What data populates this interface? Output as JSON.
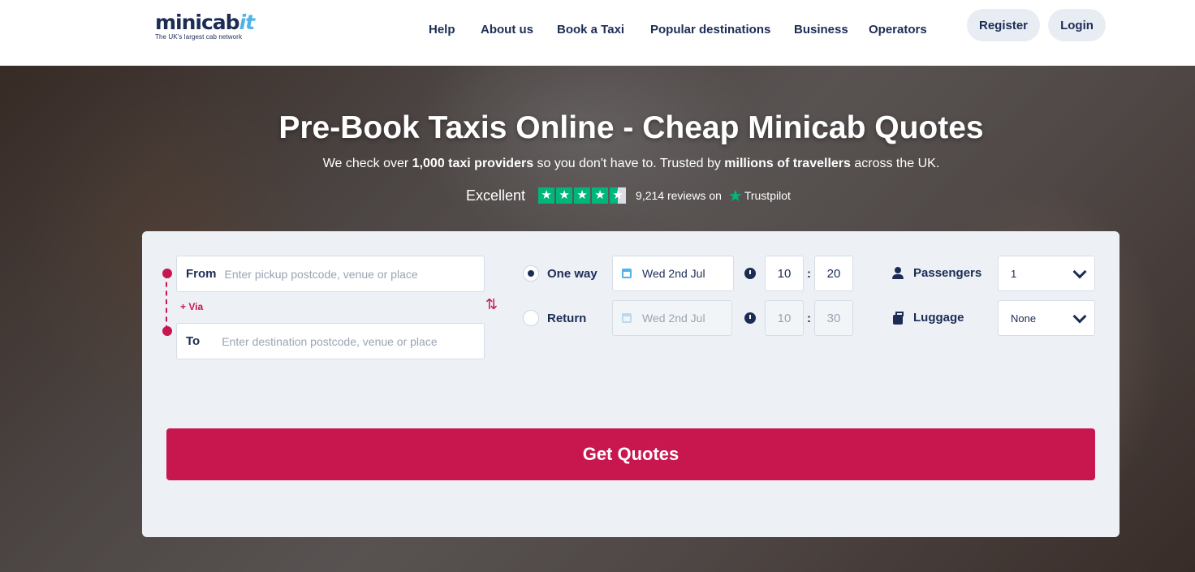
{
  "brand": {
    "logo_main": "minicab",
    "logo_accent": "it",
    "tagline": "The UK's largest cab network"
  },
  "nav": {
    "items": [
      {
        "label": "Help"
      },
      {
        "label": "About us"
      },
      {
        "label": "Book a Taxi"
      },
      {
        "label": "Popular destinations"
      },
      {
        "label": "Business"
      },
      {
        "label": "Operators"
      }
    ],
    "register_label": "Register",
    "login_label": "Login"
  },
  "hero": {
    "title": "Pre-Book Taxis Online - Cheap Minicab Quotes",
    "sub_part1": "We check over ",
    "sub_bold1": "1,000 taxi providers",
    "sub_part2": " so you don't have to. Trusted by ",
    "sub_bold2": "millions of travellers",
    "sub_part3": " across the UK."
  },
  "trustpilot": {
    "rating_text": "Excellent",
    "stars": 4.5,
    "reviews_text": "9,214 reviews on",
    "brand": "Trustpilot",
    "star_color": "#00b67a"
  },
  "form": {
    "from_label": "From",
    "from_placeholder": "Enter pickup postcode, venue or place",
    "to_label": "To",
    "to_placeholder": "Enter destination postcode, venue or place",
    "via_label": "+ Via",
    "swap_icon": "⇅",
    "one_way_label": "One way",
    "return_label": "Return",
    "trip_type_selected": "One way",
    "outbound_date": "Wed 2nd Jul",
    "outbound_hour": "10",
    "outbound_minute": "20",
    "return_date": "Wed 2nd Jul",
    "return_hour": "10",
    "return_minute": "30",
    "time_separator": ":",
    "passengers_label": "Passengers",
    "passengers_value": "1",
    "luggage_label": "Luggage",
    "luggage_value": "None",
    "submit_label": "Get Quotes"
  },
  "colors": {
    "accent": "#c8174f",
    "navy": "#1c2c55",
    "logo_accent": "#4fb3e8"
  }
}
